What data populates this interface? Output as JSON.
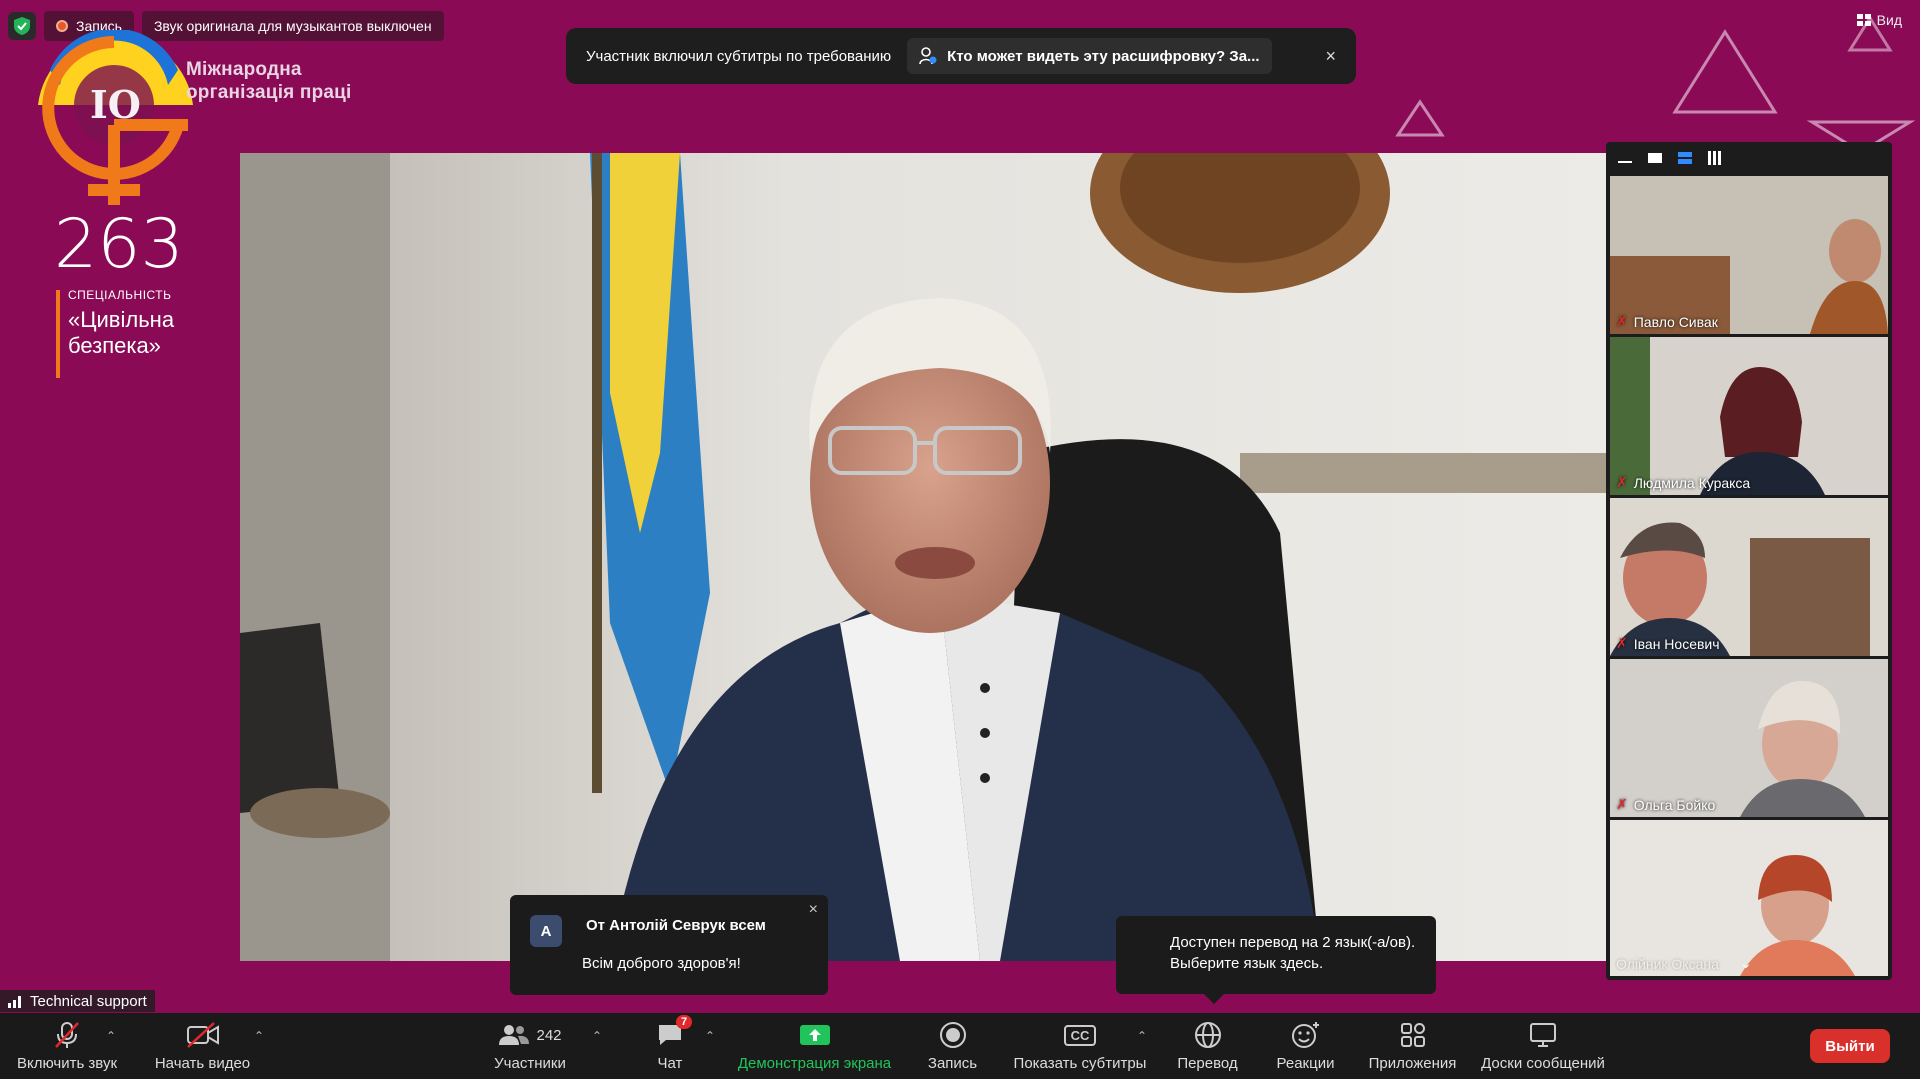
{
  "status": {
    "record_label": "Запись",
    "audio_label": "Звук оригинала для музыкантов выключен"
  },
  "banner": {
    "text": "Участник включил субтитры по требованию",
    "who_label": "Кто может видеть эту расшифровку? За...",
    "close": "×"
  },
  "view": {
    "label": "Вид"
  },
  "logo": {
    "org_name": "Міжнародна організація праці",
    "number": "263",
    "spec_small": "СПЕЦІАЛЬНІСТЬ",
    "spec_line1": "«Цивільна",
    "spec_line2": "безпека»"
  },
  "gallery": {
    "participants": [
      {
        "name": "Павло Сивак",
        "muted": true
      },
      {
        "name": "Людмила Куракса",
        "muted": true
      },
      {
        "name": "Іван Носевич",
        "muted": true
      },
      {
        "name": "Ольга Бойко",
        "muted": true
      },
      {
        "name": "Олійник Оксана",
        "muted": false
      }
    ]
  },
  "chat_notification": {
    "avatar_letter": "A",
    "from": "От Антолій Севрук всем",
    "message": "Всім доброго здоров'я!",
    "close": "×"
  },
  "translation_notification": {
    "text": "Доступен перевод на 2 язык(-а/ов). Выберите язык здесь."
  },
  "tech_support": {
    "label": "Technical support"
  },
  "toolbar": {
    "unmute": "Включить звук",
    "start_video": "Начать видео",
    "participants": "Участники",
    "participants_count": "242",
    "chat": "Чат",
    "chat_badge": "7",
    "share_screen": "Демонстрация экрана",
    "record": "Запись",
    "captions": "Показать субтитры",
    "captions_icon": "CC",
    "translate": "Перевод",
    "reactions": "Реакции",
    "apps": "Приложения",
    "whiteboards": "Доски сообщений",
    "leave": "Выйти"
  },
  "colors": {
    "background": "#8a0a55",
    "accent_orange": "#f07a1a",
    "share_green": "#21c45a",
    "leave_red": "#d9302b"
  }
}
